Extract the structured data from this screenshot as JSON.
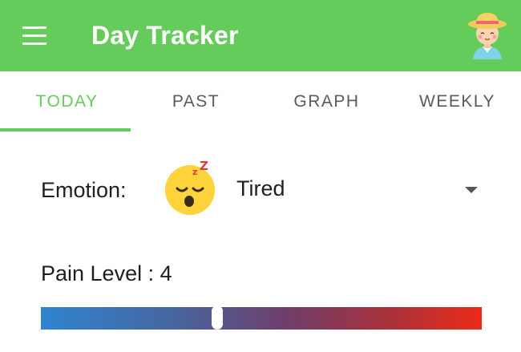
{
  "app": {
    "title": "Day Tracker",
    "theme_color": "#65cc5c",
    "menu_icon": "hamburger-menu-icon",
    "avatar_icon": "farmer-avatar-icon"
  },
  "tabs": [
    {
      "label": "TODAY",
      "active": true
    },
    {
      "label": "PAST",
      "active": false
    },
    {
      "label": "GRAPH",
      "active": false
    },
    {
      "label": "WEEKLY",
      "active": false
    }
  ],
  "emotion": {
    "label": "Emotion:",
    "selected": "Tired",
    "icon": "tired-sleeping-emoji-icon"
  },
  "pain": {
    "label": "Pain Level : 4",
    "value": 4,
    "max": 10,
    "gradient_start": "#2f84cf",
    "gradient_end": "#ec2c18"
  }
}
